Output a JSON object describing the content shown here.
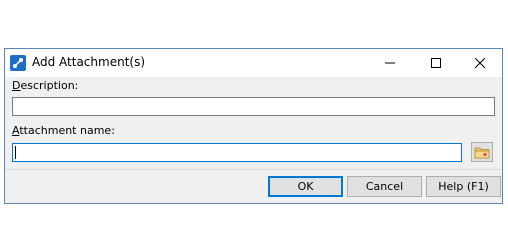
{
  "window": {
    "title": "Add Attachment(s)",
    "minimize_glyph": "–",
    "maximize_glyph": "☐",
    "close_glyph": "✕"
  },
  "form": {
    "description_label_mnemonic": "D",
    "description_label_rest": "escription:",
    "description_value": "",
    "attachment_label_mnemonic": "A",
    "attachment_label_rest": "ttachment name:",
    "attachment_value": ""
  },
  "buttons": {
    "ok": "OK",
    "cancel": "Cancel",
    "help": "Help (F1)"
  },
  "icons": {
    "app": "app-icon",
    "browse": "folder-icon"
  },
  "colors": {
    "accent": "#0078d7",
    "border": "#5b86b8",
    "app_icon": "#1f6fc6"
  }
}
